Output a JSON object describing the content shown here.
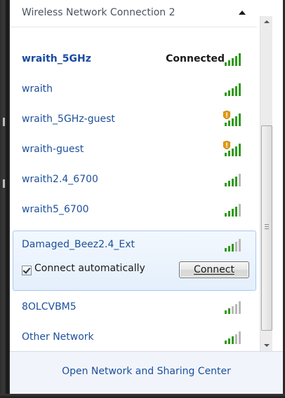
{
  "section": {
    "title": "Wireless Network Connection 2"
  },
  "networks": [
    {
      "name": "wraith_5GHz",
      "status": "Connected",
      "signal": 5,
      "secured": true,
      "warning": false
    },
    {
      "name": "wraith",
      "status": "",
      "signal": 5,
      "secured": true,
      "warning": false
    },
    {
      "name": "wraith_5GHz-guest",
      "status": "",
      "signal": 5,
      "secured": false,
      "warning": true
    },
    {
      "name": "wraith-guest",
      "status": "",
      "signal": 5,
      "secured": false,
      "warning": true
    },
    {
      "name": "wraith2.4_6700",
      "status": "",
      "signal": 4,
      "secured": true,
      "warning": false
    },
    {
      "name": "wraith5_6700",
      "status": "",
      "signal": 4,
      "secured": true,
      "warning": false
    }
  ],
  "selected_network": {
    "name": "Damaged_Beez2.4_Ext",
    "signal": 3,
    "connect_automatically_label": "Connect automatically",
    "connect_automatically_checked": true,
    "connect_button_label": "Connect"
  },
  "other_networks": [
    {
      "name": "8OLCVBM5",
      "signal": 2
    },
    {
      "name": "Other Network",
      "signal": 3
    }
  ],
  "footer": {
    "link_label": "Open Network and Sharing Center"
  },
  "colors": {
    "link_blue": "#1d4f9c",
    "signal_green": "#2f9a1a",
    "signal_empty": "#b9b9b9",
    "warning_orange": "#e39b12",
    "selected_border": "#a9c8ee"
  },
  "icons": {
    "collapse": "caret-up-icon",
    "signal": "wifi-signal-icon",
    "warning": "shield-warning-icon",
    "scroll_up": "scroll-up-arrow-icon",
    "scroll_down": "scroll-down-arrow-icon"
  }
}
